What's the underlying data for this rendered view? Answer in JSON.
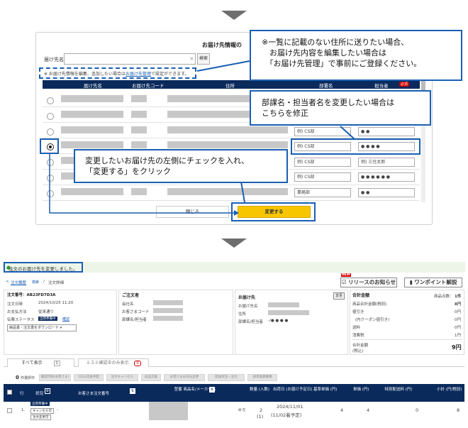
{
  "modal": {
    "title": "お届け先情報の",
    "dest_label": "届け先名",
    "search_clear": "×",
    "search_button": "検索",
    "hint_text": "※ お届け先情報を編集、追加したい場合は",
    "hint_link": "お届け先管理",
    "hint_suffix": "で設定ができます。",
    "columns": [
      "届け先名",
      "お届け先コード",
      "住所",
      "部署名",
      "担当者"
    ],
    "required_badge": "必須",
    "rows": [
      {
        "dept": "",
        "person": ""
      },
      {
        "dept": "例) CS部",
        "person": "● ●"
      },
      {
        "dept": "例) CS部",
        "person": "● ● ● ●"
      },
      {
        "dept": "例) CS部",
        "person": "例) 三住太郎"
      },
      {
        "dept": "例) CS部",
        "person": "● ● ● ● ● ●"
      },
      {
        "dept": "業務部",
        "person": "● ●"
      }
    ],
    "selected_row": 2,
    "close_button": "閉じる",
    "change_button": "変更する"
  },
  "callouts": {
    "top_right": [
      "※一覧に記載のない住所に送りたい場合、",
      "　お届け先内容を編集したい場合は",
      "　「お届け先管理」で事前にご登録ください。"
    ],
    "middle": [
      "部課名・担当者名を変更したい場合は",
      "こちらを修正"
    ],
    "left": [
      "変更したいお届け先の左側にチェックを入れ、",
      "「変更する」をクリック"
    ]
  },
  "order": {
    "notice": "注文のお届け先を変更しました。",
    "breadcrumb": {
      "back": "<",
      "link": "注文履歴",
      "sub": "検索",
      "sep": "/",
      "current": "注文詳細"
    },
    "new_badge": "NEW",
    "release_button": "リリースのお知らせ",
    "tips_button": "ワンポイント解説",
    "info": {
      "order_no_label": "注文番号：AB23FD7D3A",
      "order_date_label": "注文日時",
      "order_date": "2024/10/25 11:20",
      "payment_label": "お支払方法",
      "payment": "従来通り",
      "status_label": "伝票ステータス",
      "status_chip": "出荷準備中",
      "status_link": "確認",
      "download_select": "納品書・注文書をダウンロード"
    },
    "orderer": {
      "title": "ご注文者",
      "company": "会社名",
      "customer_code": "お客さまコード",
      "dept": "部課名/担当者"
    },
    "delivery": {
      "title": "お届け先",
      "change": "変更",
      "dest": "お届け先名",
      "address": "住所",
      "dept": "部課名/担当者",
      "dept_value": "-/● ● ● ●"
    },
    "totals": {
      "title": "合計金額",
      "lines": [
        {
          "label": "",
          "sub": "商品点数：",
          "value": "1件"
        },
        {
          "label": "商品合計金額(税別)",
          "value": "8円"
        },
        {
          "label": "値引き",
          "value": "0円"
        },
        {
          "label": "(内クーポン値引き)",
          "value": "0円"
        },
        {
          "label": "送料",
          "value": "0円"
        },
        {
          "label": "消費税",
          "value": "1円"
        }
      ],
      "grand_label": "合計金額",
      "grand_sub": "(税込)",
      "grand_value": "9円"
    },
    "tabs": [
      {
        "label": "すべて表示",
        "count": "1"
      },
      {
        "label": "ミスミ確認中のみ表示",
        "count": "0"
      }
    ],
    "selected_count": "0",
    "selected_label": "件選択中",
    "action_buttons": [
      "確認印刷(お客さま)",
      "1日以内再手配",
      "注文キャンセル",
      "返品交換",
      "お客さまお支払変更",
      "配送状況・注文",
      "請求金額書類"
    ],
    "table_headers": [
      "行",
      "状況",
      "お客さま注文番号",
      "型番 商品名/メーカー名",
      "数量 (入数)",
      "出荷日 (お届け予定日)",
      "基準単価 (円)",
      "単価 (円)",
      "特別配送料 (円)",
      "小計 (円/税別)"
    ],
    "row": {
      "no": "1.",
      "chips": [
        "出荷準備中",
        "キャンセル可",
        "注文変更可"
      ],
      "order_no": "-",
      "qty": "2",
      "qty_sub": "(1)",
      "ship": "2024/11/01",
      "ship_sub": "(11/02着予定)",
      "base_price": "4",
      "price": "4",
      "shipping": "0",
      "subtotal": "8",
      "maker_tag": "材 在"
    }
  }
}
